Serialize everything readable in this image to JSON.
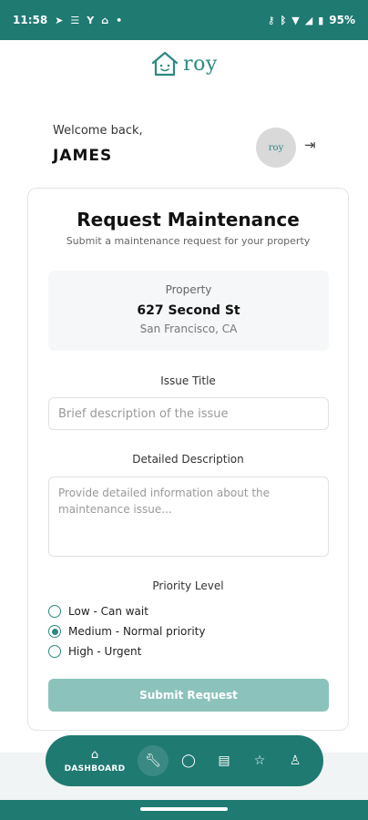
{
  "status_bar": {
    "time": "11:58",
    "battery": "95%",
    "icons": [
      "telegram-icon",
      "signal-icon",
      "wifi-icon",
      "home-icon",
      "dot-icon",
      "key-icon",
      "bluetooth-icon",
      "battery-icon"
    ]
  },
  "brand": {
    "logo_text": "roy",
    "color": "#1f7a72",
    "accent_light": "#8cc2bc"
  },
  "header": {
    "welcome_label": "Welcome back,",
    "user_name": "JAMES",
    "avatar_text": "roy"
  },
  "form": {
    "title": "Request Maintenance",
    "subtitle": "Submit a maintenance request for your property",
    "property": {
      "label": "Property",
      "address": "627 Second St",
      "city": "San Francisco, CA"
    },
    "issue_title": {
      "label": "Issue Title",
      "placeholder": "Brief description of the issue",
      "value": ""
    },
    "description": {
      "label": "Detailed Description",
      "placeholder": "Provide detailed information about the maintenance issue...",
      "value": ""
    },
    "priority": {
      "label": "Priority Level",
      "options": [
        {
          "label": "Low - Can wait",
          "selected": false
        },
        {
          "label": "Medium - Normal priority",
          "selected": true
        },
        {
          "label": "High - Urgent",
          "selected": false
        }
      ]
    },
    "submit_label": "Submit Request"
  },
  "nav": {
    "active_label": "DASHBOARD",
    "items": [
      "home-icon",
      "wrench-icon",
      "chat-icon",
      "document-icon",
      "star-icon",
      "person-icon"
    ]
  }
}
